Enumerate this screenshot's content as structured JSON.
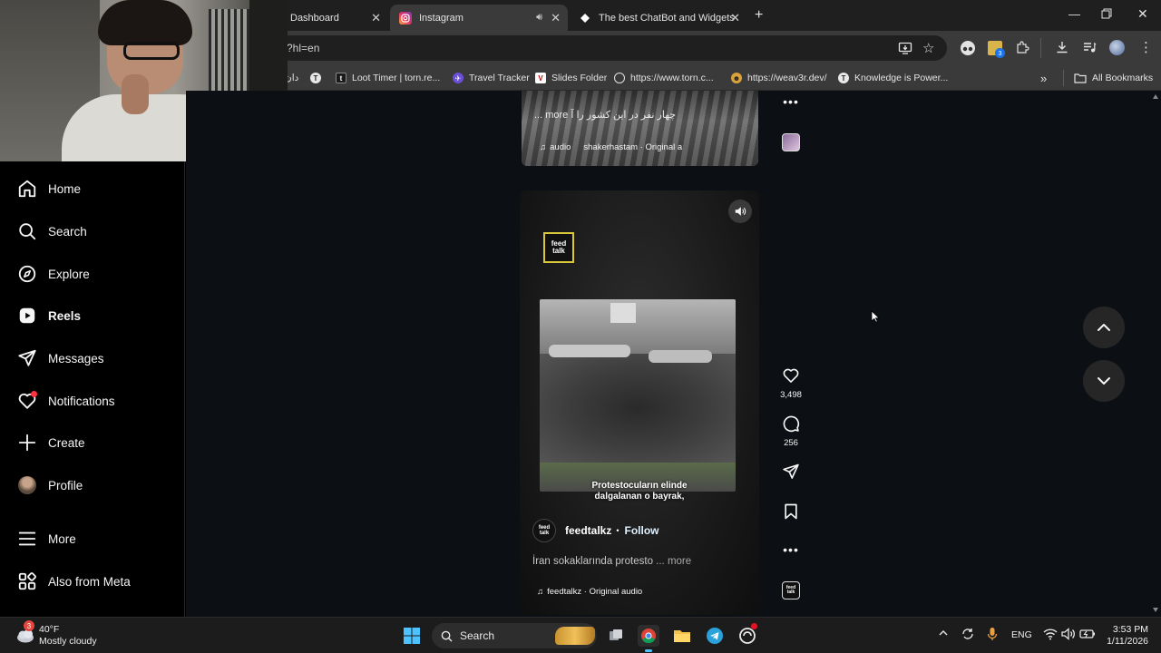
{
  "browser": {
    "tabs": [
      {
        "label": "Dashboard"
      },
      {
        "label": "Instagram"
      },
      {
        "label": "The best ChatBot and Widgets f"
      }
    ],
    "new_tab": "+",
    "address": "?hl=en",
    "bookmarks": [
      {
        "label": "دان"
      },
      {
        "label": "Loot Timer | torn.re..."
      },
      {
        "label": "Travel Tracker"
      },
      {
        "label": "Slides Folder"
      },
      {
        "label": "https://www.torn.c..."
      },
      {
        "label": "https://weav3r.dev/"
      },
      {
        "label": "Knowledge is Power..."
      }
    ],
    "bookmarks_more": "»",
    "all_bookmarks": "All Bookmarks",
    "extension_badge": "3"
  },
  "sidebar": {
    "items": [
      {
        "label": "Home"
      },
      {
        "label": "Search"
      },
      {
        "label": "Explore"
      },
      {
        "label": "Reels"
      },
      {
        "label": "Messages"
      },
      {
        "label": "Notifications"
      },
      {
        "label": "Create"
      },
      {
        "label": "Profile"
      },
      {
        "label": "More"
      },
      {
        "label": "Also from Meta"
      }
    ]
  },
  "prev_post": {
    "caption": "... more چهار نفر در این کشور را آ",
    "audio": "audio",
    "audio_author": "shakerhastam · Original a"
  },
  "post": {
    "logo_text": "feed talk",
    "subtitle_line1": "Protestocuların elinde",
    "subtitle_line2": "dalgalanan o bayrak,",
    "author": "feedtalkz",
    "dot": "•",
    "follow": "Follow",
    "caption": "İran sokaklarında protesto",
    "more": "... more",
    "audio": "feedtalkz · Original audio",
    "likes": "3,498",
    "comments": "256"
  },
  "taskbar": {
    "weather_badge": "3",
    "temperature": "40°F",
    "weather_desc": "Mostly cloudy",
    "search": "Search",
    "language": "ENG",
    "time": "3:53 PM",
    "date": "1/11/2026"
  },
  "colors": {
    "feed_bg": "#0c1014",
    "notification_dot": "#ff3040",
    "follow_text": "#e0f1ff"
  }
}
